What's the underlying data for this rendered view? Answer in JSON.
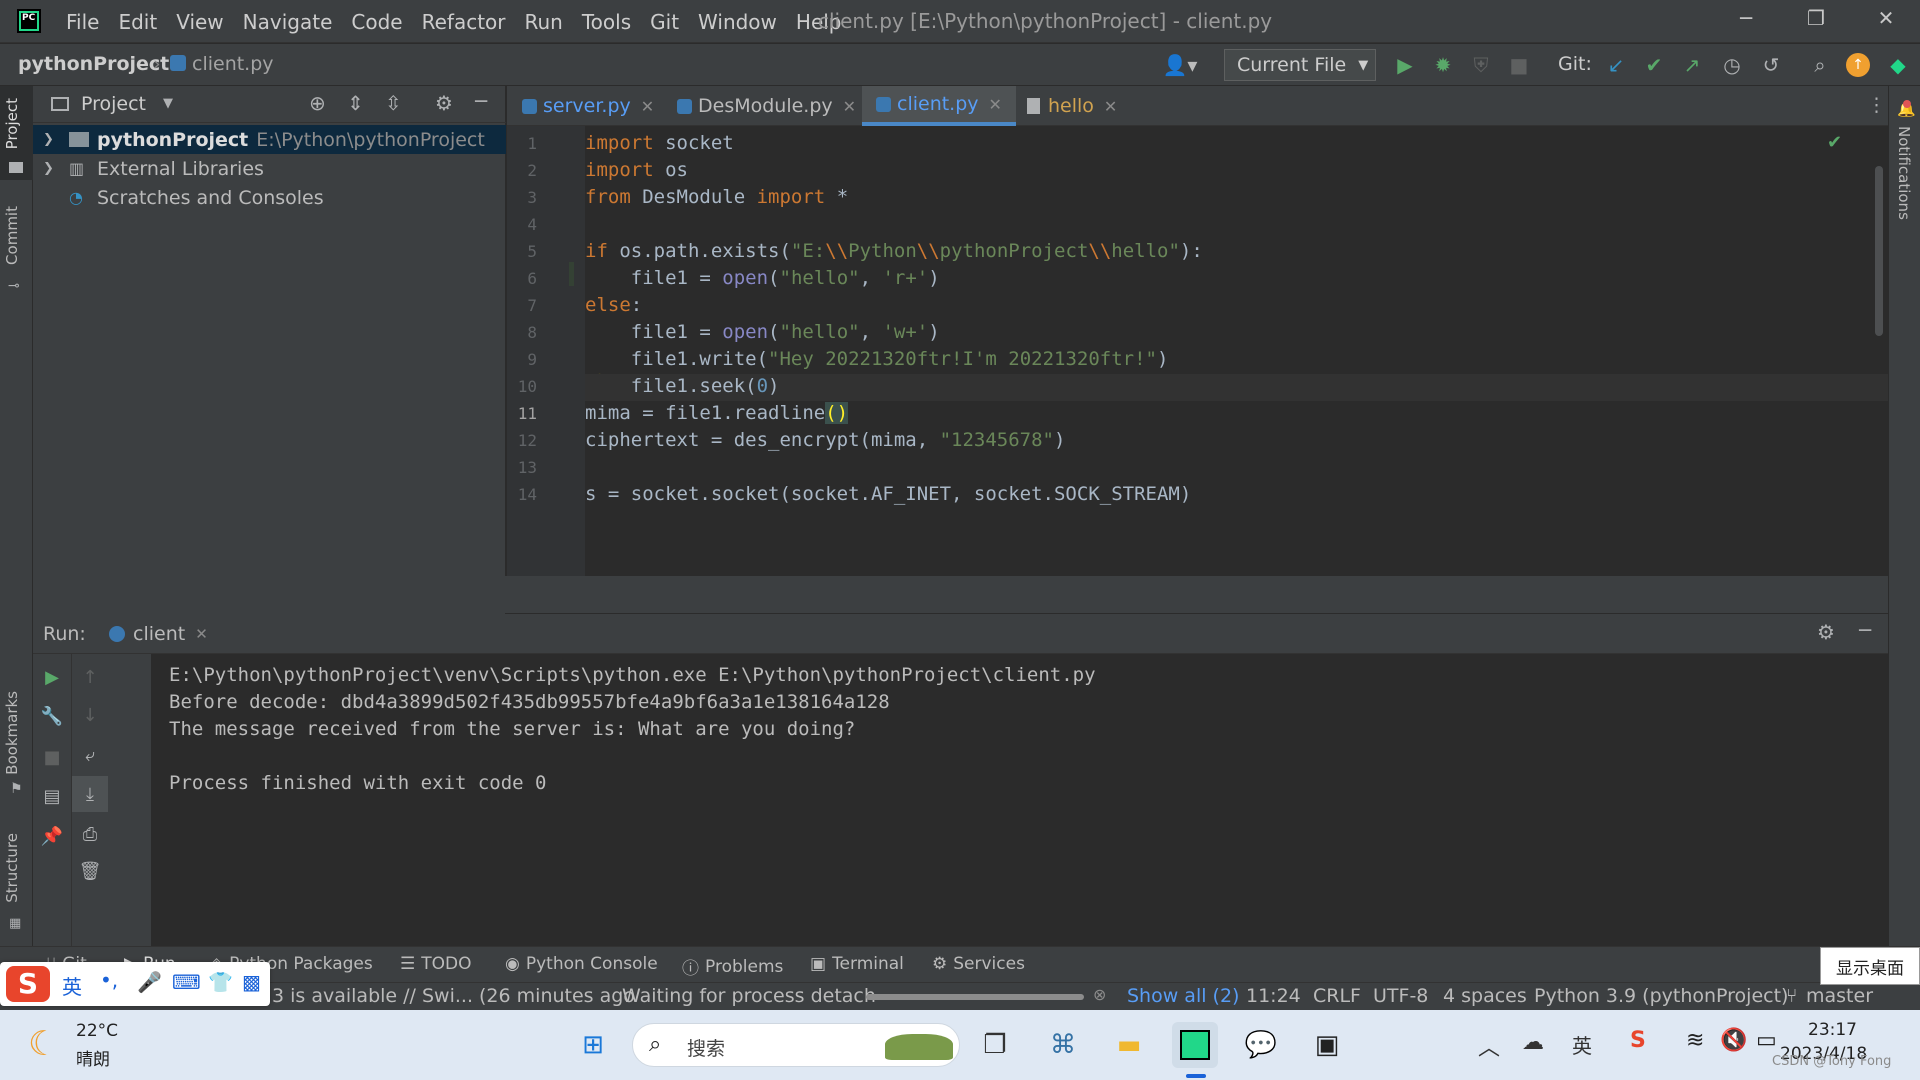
{
  "titlebar": {
    "menu": [
      "File",
      "Edit",
      "View",
      "Navigate",
      "Code",
      "Refactor",
      "Run",
      "Tools",
      "Git",
      "Window",
      "Help"
    ],
    "window_title": "client.py [E:\\Python\\pythonProject] - client.py"
  },
  "navbar": {
    "project": "pythonProject",
    "file": "client.py",
    "run_config": "Current File",
    "git_label": "Git:"
  },
  "leftstrip": {
    "project": "Project",
    "commit": "Commit",
    "bookmarks": "Bookmarks",
    "structure": "Structure"
  },
  "rightstrip": {
    "notifications": "Notifications"
  },
  "project_panel": {
    "title": "Project",
    "items": [
      {
        "label": "pythonProject",
        "path": "E:\\Python\\pythonProject"
      },
      {
        "label": "External Libraries"
      },
      {
        "label": "Scratches and Consoles"
      }
    ]
  },
  "editor": {
    "tabs": [
      {
        "label": "server.py"
      },
      {
        "label": "DesModule.py"
      },
      {
        "label": "client.py"
      },
      {
        "label": "hello"
      }
    ],
    "line_numbers": [
      "1",
      "2",
      "3",
      "4",
      "5",
      "6",
      "7",
      "8",
      "9",
      "10",
      "11",
      "12",
      "13",
      "14"
    ]
  },
  "run_panel": {
    "label": "Run:",
    "tab": "client",
    "output": [
      "E:\\Python\\pythonProject\\venv\\Scripts\\python.exe E:\\Python\\pythonProject\\client.py",
      "Before decode: dbd4a3899d502f435db99557bfe4a9bf6a3a1e138164a128",
      "The message received from the server is: What are you doing?",
      "",
      "Process finished with exit code 0"
    ]
  },
  "bottom_tabs": [
    "Git",
    "Run",
    "Python Packages",
    "TODO",
    "Python Console",
    "Problems",
    "Terminal",
    "Services"
  ],
  "statusbar": {
    "message": "3 is available // Swi... (26 minutes ago",
    "process": "Waiting for process detach",
    "show_all": "Show all (2)",
    "position": "11:24",
    "line_sep": "CRLF",
    "encoding": "UTF-8",
    "indent": "4 spaces",
    "interpreter": "Python 3.9 (pythonProject)",
    "branch": "master"
  },
  "tooltip": "显示桌面",
  "taskbar": {
    "weather_temp": "22°C",
    "weather_desc": "晴朗",
    "search_placeholder": "搜索",
    "time": "23:17",
    "date": "2023/4/18",
    "ime_lang": "英",
    "tray_lang": "英",
    "watermark": "CSDN @Tony Fong"
  },
  "colors": {
    "accent": "#4a88c7",
    "keyword": "#cc7832",
    "string": "#6a8759",
    "number": "#6897bb",
    "builtin": "#8888c6"
  }
}
